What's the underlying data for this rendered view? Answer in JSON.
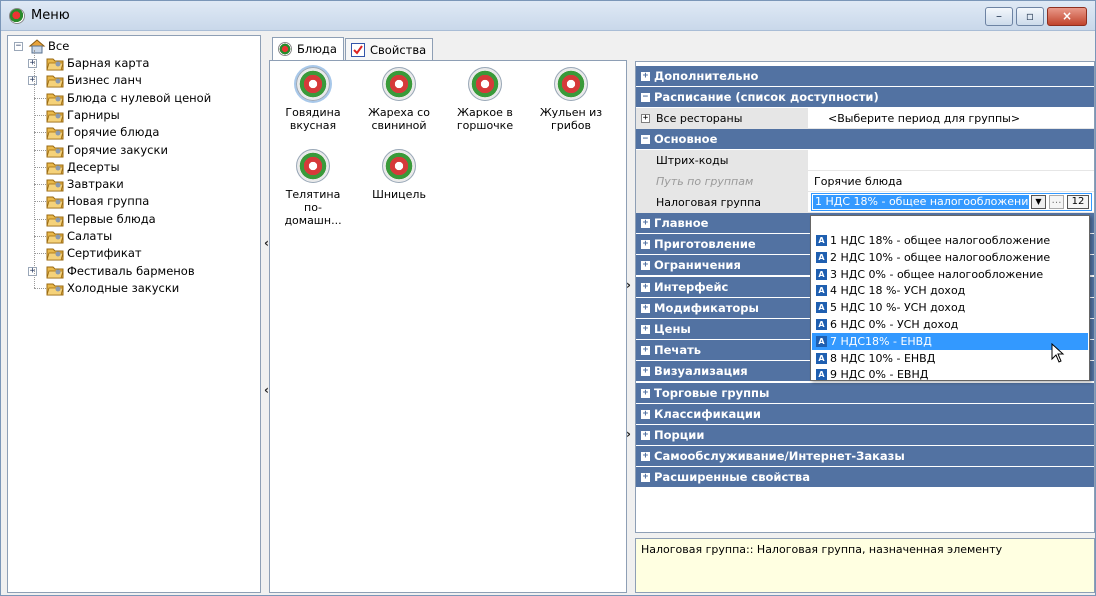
{
  "window": {
    "title": "Меню"
  },
  "tree": {
    "root": "Все",
    "items": [
      {
        "label": "Барная карта",
        "expandable": true
      },
      {
        "label": "Бизнес ланч",
        "expandable": true
      },
      {
        "label": "Блюда с нулевой ценой",
        "expandable": false
      },
      {
        "label": "Гарниры",
        "expandable": false
      },
      {
        "label": "Горячие блюда",
        "expandable": false
      },
      {
        "label": "Горячие закуски",
        "expandable": false
      },
      {
        "label": "Десерты",
        "expandable": false
      },
      {
        "label": "Завтраки",
        "expandable": false
      },
      {
        "label": "Новая группа",
        "expandable": false
      },
      {
        "label": "Первые блюда",
        "expandable": false
      },
      {
        "label": "Салаты",
        "expandable": false
      },
      {
        "label": "Сертификат",
        "expandable": false
      },
      {
        "label": "Фестиваль барменов",
        "expandable": true
      },
      {
        "label": "Холодные закуски",
        "expandable": false
      }
    ]
  },
  "tabs": [
    {
      "label": "Блюда",
      "active": true
    },
    {
      "label": "Свойства",
      "active": false
    }
  ],
  "dishes": [
    {
      "line1": "Говядина",
      "line2": "вкусная",
      "selected": true
    },
    {
      "line1": "Жареха со",
      "line2": "свининой",
      "selected": false
    },
    {
      "line1": "Жаркое в",
      "line2": "горшочке",
      "selected": false
    },
    {
      "line1": "Жульен из",
      "line2": "грибов",
      "selected": false
    },
    {
      "line1": "Телятина",
      "line2": "по-домашн...",
      "selected": false
    },
    {
      "line1": "Шницель",
      "line2": "",
      "selected": false
    }
  ],
  "properties": {
    "cat_additional": "Дополнительно",
    "cat_schedule": "Расписание (список доступности)",
    "all_restaurants_name": "Все рестораны",
    "all_restaurants_value": "<Выберите период для группы>",
    "cat_main_basic": "Основное",
    "barcodes_name": "Штрих-коды",
    "group_path_name": "Путь по группам",
    "group_path_value": "Горячие блюда",
    "tax_group_name": "Налоговая группа",
    "tax_group_value": "1 НДС 18% - общее налогообложение",
    "tax_group_num": "12",
    "more_categories": [
      "Главное",
      "Приготовление",
      "Ограничения",
      "Интерфейс",
      "Модификаторы",
      "Цены",
      "Печать",
      "Визуализация",
      "Торговые группы",
      "Классификации",
      "Порции",
      "Самообслуживание/Интернет-Заказы",
      "Расширенные свойства"
    ]
  },
  "tax_dropdown": {
    "highlighted_index": 6,
    "options": [
      "1 НДС 18% - общее налогообложение",
      "2 НДС 10% - общее налогообложение",
      "3 НДС 0% - общее налогообложение",
      "4 НДС 18 %- УСН доход",
      "5 НДС 10 %- УСН доход",
      "6 НДС 0% - УСН доход",
      "7 НДС18% - ЕНВД",
      "8 НДС 10% - ЕНВД",
      "9 НДС 0% - ЕВНД"
    ]
  },
  "description": "Налоговая группа:: Налоговая группа, назначенная элементу",
  "colors": {
    "category_bg": "#5272a2",
    "selection": "#3399ff",
    "description_bg": "#ffffe1"
  }
}
